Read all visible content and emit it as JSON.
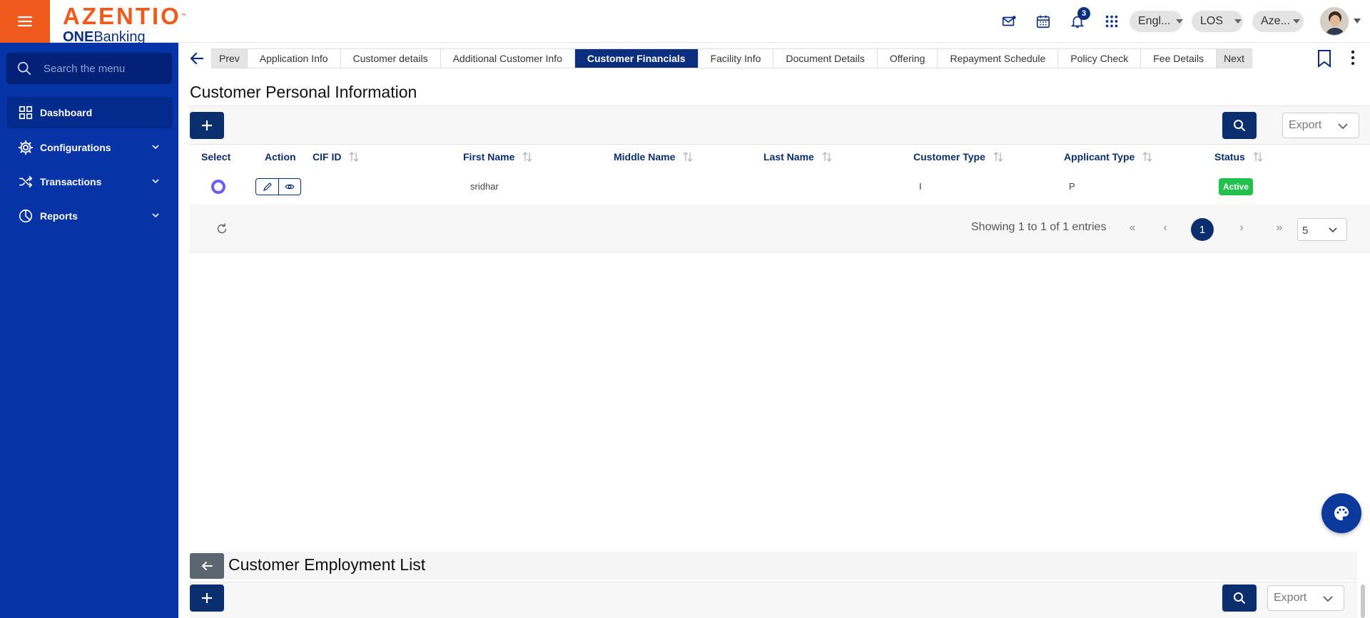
{
  "header": {
    "logo_main": "AZENTIO",
    "logo_tm": "™",
    "logo_sub_bold": "ONE",
    "logo_sub_rest": "Banking",
    "notification_count": "3",
    "language": "Engl...",
    "module": "LOS",
    "tenant": "Aze..."
  },
  "sidebar": {
    "search_placeholder": "Search the menu",
    "items": [
      {
        "label": "Dashboard",
        "icon": "grid-icon"
      },
      {
        "label": "Configurations",
        "icon": "gear-icon"
      },
      {
        "label": "Transactions",
        "icon": "shuffle-icon"
      },
      {
        "label": "Reports",
        "icon": "pie-chart-icon"
      }
    ]
  },
  "tabs": {
    "prev": "Prev",
    "next": "Next",
    "items": [
      "Application Info",
      "Customer details",
      "Additional Customer Info",
      "Customer Financials",
      "Facility Info",
      "Document Details",
      "Offering",
      "Repayment Schedule",
      "Policy Check",
      "Fee Details"
    ],
    "active": "Customer Financials"
  },
  "personal": {
    "title": "Customer Personal Information",
    "export_label": "Export",
    "columns": [
      "Select",
      "Action",
      "CIF ID",
      "First Name",
      "Middle Name",
      "Last Name",
      "Customer Type",
      "Applicant Type",
      "Status"
    ],
    "row": {
      "cif_id": "",
      "first_name": "sridhar",
      "middle_name": "",
      "last_name": "",
      "customer_type": "I",
      "applicant_type": "P",
      "status": "Active"
    },
    "showing": "Showing 1 to 1 of 1 entries",
    "current_page": "1",
    "page_size": "5",
    "pager_first": "«",
    "pager_prev": "‹",
    "pager_next": "›",
    "pager_last": "»"
  },
  "employment": {
    "title": "Customer Employment List",
    "export_label": "Export"
  },
  "colors": {
    "brand_orange": "#f05a1c",
    "sidebar_blue": "#0633a6",
    "primary_navy": "#0b2f6e",
    "status_green": "#22c04d"
  }
}
